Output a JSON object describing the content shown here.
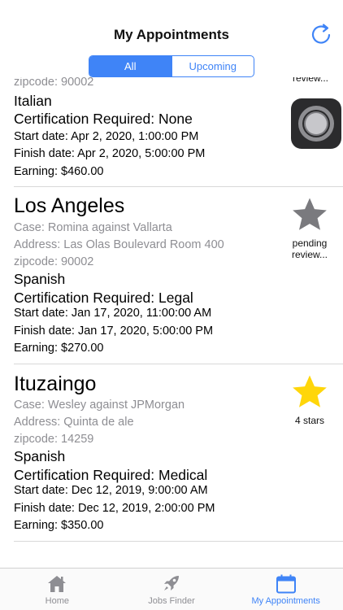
{
  "header": {
    "title": "My Appointments",
    "refresh_icon": "refresh-icon",
    "accent": "#3f84f7"
  },
  "segment": {
    "all": "All",
    "upcoming": "Upcoming",
    "selected": "All"
  },
  "appointments": [
    {
      "partial_zip": "zipcode: 90002",
      "partial_status": "review...",
      "language": "Italian",
      "certification": "Certification Required: None",
      "start": "Start date: Apr 2, 2020, 1:00:00 PM",
      "finish": "Finish date: Apr 2, 2020, 5:00:00 PM",
      "earning": "Earning: $460.00",
      "side_icon": "app-icon"
    },
    {
      "city": "Los Angeles",
      "case": "Case: Romina against Vallarta",
      "address": "Address: Las Olas Boulevard Room 400",
      "zip": "zipcode: 90002",
      "language": "Spanish",
      "certification": "Certification Required: Legal",
      "start": "Start date: Jan 17, 2020, 11:00:00 AM",
      "finish": "Finish date: Jan 17, 2020, 5:00:00 PM",
      "earning": "Earning: $270.00",
      "rating_line1": "pending",
      "rating_line2": "review...",
      "star_color": "#7a7a7e",
      "side_icon": "star-icon"
    },
    {
      "city": "Ituzaingo",
      "case": "Case: Wesley against JPMorgan",
      "address": "Address: Quinta de ale",
      "zip": "zipcode: 14259",
      "language": "Spanish",
      "certification": "Certification Required: Medical",
      "start": "Start date: Dec 12, 2019, 9:00:00 AM",
      "finish": "Finish date: Dec 12, 2019, 2:00:00 PM",
      "earning": "Earning: $350.00",
      "rating_line1": "4 stars",
      "star_color": "#ffd60a",
      "side_icon": "star-icon"
    }
  ],
  "tabbar": {
    "items": [
      {
        "label": "Home",
        "icon": "home-icon"
      },
      {
        "label": "Jobs Finder",
        "icon": "rocket-icon"
      },
      {
        "label": "My Appointments",
        "icon": "calendar-icon"
      }
    ],
    "active": "My Appointments",
    "inactive_color": "#8e8e93"
  }
}
